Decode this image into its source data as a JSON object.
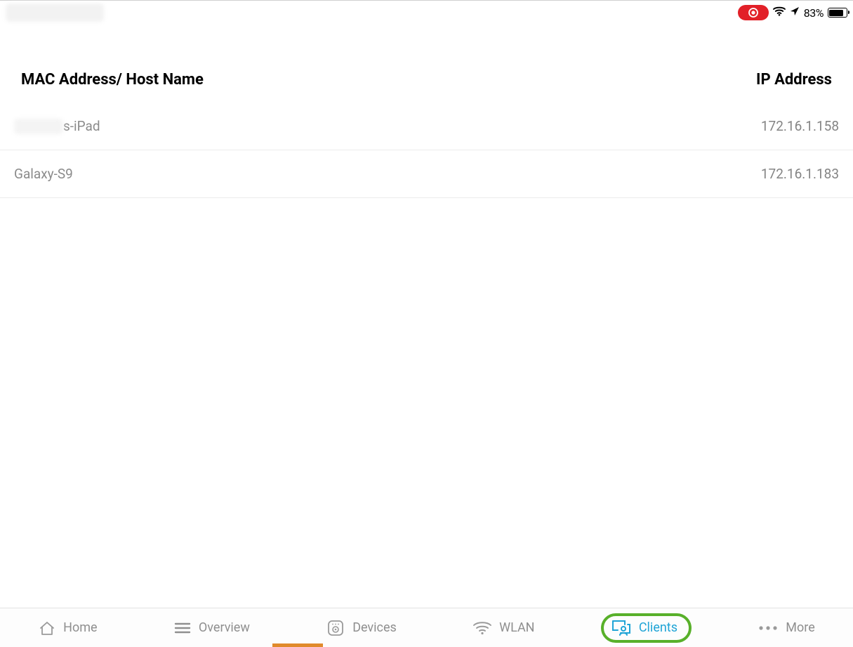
{
  "status": {
    "battery_percent": "83%"
  },
  "header": {
    "col_left": "MAC Address/ Host Name",
    "col_right": "IP Address"
  },
  "clients": [
    {
      "hostname_suffix": "s-iPad",
      "blurred_prefix": true,
      "ip": "172.16.1.158"
    },
    {
      "hostname": "Galaxy-S9",
      "blurred_prefix": false,
      "ip": "172.16.1.183"
    }
  ],
  "tabs": {
    "home": "Home",
    "overview": "Overview",
    "devices": "Devices",
    "wlan": "WLAN",
    "clients": "Clients",
    "more": "More"
  }
}
